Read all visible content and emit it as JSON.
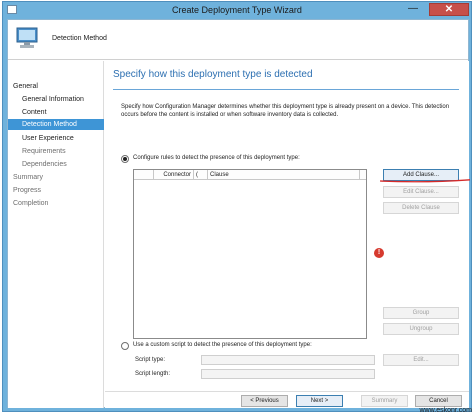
{
  "window": {
    "title": "Create Deployment Type Wizard",
    "minimize_glyph": "—",
    "close_glyph": "✕"
  },
  "header": {
    "title": "Detection Method",
    "icon": "computer-monitor-icon"
  },
  "sidebar": {
    "items": [
      {
        "label": "General",
        "level": "top",
        "state": "normal"
      },
      {
        "label": "General Information",
        "level": "sub",
        "state": "normal"
      },
      {
        "label": "Content",
        "level": "sub",
        "state": "normal"
      },
      {
        "label": "Detection Method",
        "level": "sub",
        "state": "selected"
      },
      {
        "label": "User Experience",
        "level": "sub",
        "state": "normal"
      },
      {
        "label": "Requirements",
        "level": "sub",
        "state": "disabled"
      },
      {
        "label": "Dependencies",
        "level": "sub",
        "state": "disabled"
      },
      {
        "label": "Summary",
        "level": "top",
        "state": "disabled"
      },
      {
        "label": "Progress",
        "level": "top",
        "state": "disabled"
      },
      {
        "label": "Completion",
        "level": "top",
        "state": "disabled"
      }
    ]
  },
  "main": {
    "title": "Specify how this deployment type is detected",
    "description": "Specify how Configuration Manager determines whether this deployment type is already present on a device. This detection occurs before the content is installed or when software inventory data is collected.",
    "option_rules": {
      "label": "Configure rules to detect the presence of this deployment type:",
      "checked": true
    },
    "grid": {
      "columns": [
        "",
        "Connector",
        "(",
        "Clause",
        ""
      ]
    },
    "buttons": {
      "add_clause": "Add Clause...",
      "edit_clause": "Edit Clause...",
      "delete_clause": "Delete Clause",
      "group": "Group",
      "ungroup": "Ungroup",
      "edit": "Edit..."
    },
    "option_script": {
      "label": "Use a custom script to detect the presence of this deployment type:",
      "checked": false
    },
    "script_type_label": "Script type:",
    "script_length_label": "Script length:",
    "error_glyph": "!"
  },
  "footer": {
    "previous": "< Previous",
    "next": "Next >",
    "summary": "Summary",
    "cancel": "Cancel"
  },
  "watermark": "www.eskonr.com",
  "colors": {
    "accent": "#3e95d6",
    "title_blue": "#2c6fb1",
    "annotation_red": "#d42a2a",
    "frame": "#6fb2dc"
  }
}
